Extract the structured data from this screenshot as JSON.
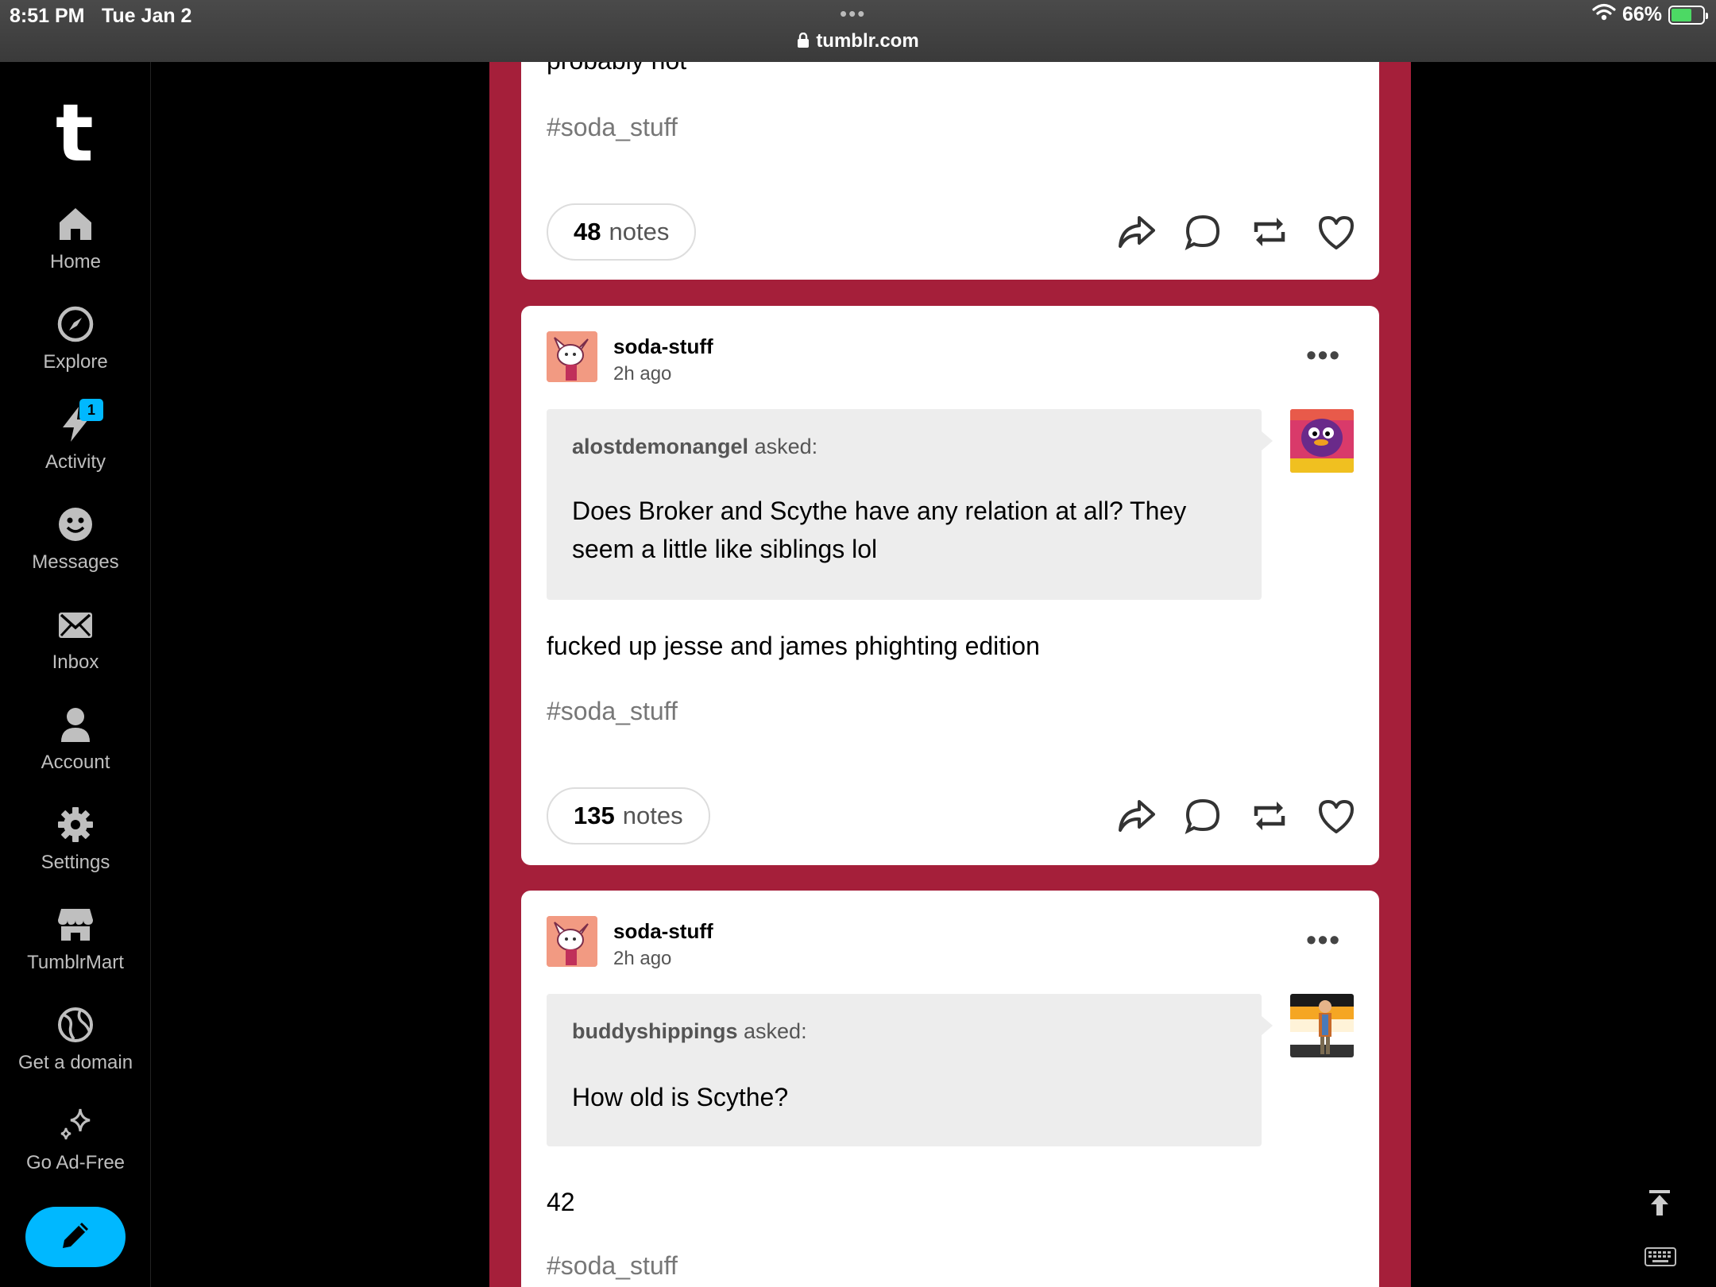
{
  "status_bar": {
    "time": "8:51 PM",
    "date": "Tue Jan 2",
    "url": "tumblr.com",
    "battery": "66%",
    "battery_level": 0.66
  },
  "sidebar": {
    "logo": "t",
    "items": [
      {
        "label": "Home",
        "icon": "home-icon"
      },
      {
        "label": "Explore",
        "icon": "compass-icon"
      },
      {
        "label": "Activity",
        "icon": "lightning-icon",
        "badge": "1"
      },
      {
        "label": "Messages",
        "icon": "smiley-icon"
      },
      {
        "label": "Inbox",
        "icon": "envelope-icon"
      },
      {
        "label": "Account",
        "icon": "person-icon"
      },
      {
        "label": "Settings",
        "icon": "gear-icon"
      },
      {
        "label": "TumblrMart",
        "icon": "store-icon"
      },
      {
        "label": "Get a domain",
        "icon": "globe-icon"
      },
      {
        "label": "Go Ad-Free",
        "icon": "sparkle-icon"
      }
    ],
    "compose_icon": "pencil-icon"
  },
  "posts": [
    {
      "cut_text": "probably not",
      "tag": "#soda_stuff",
      "notes_count": "48",
      "notes_label": "notes"
    },
    {
      "blog": "soda-stuff",
      "time": "2h ago",
      "asker": "alostdemonangel",
      "asked_label": "asked:",
      "question": "Does Broker and Scythe have any relation at all? They seem a little like siblings lol",
      "answer": "fucked up jesse and james phighting edition",
      "tag": "#soda_stuff",
      "notes_count": "135",
      "notes_label": "notes"
    },
    {
      "blog": "soda-stuff",
      "time": "2h ago",
      "asker": "buddyshippings",
      "asked_label": "asked:",
      "question": "How old is Scythe?",
      "answer": "42",
      "tag": "#soda_stuff"
    }
  ],
  "colors": {
    "feed_background": "#a51f3a",
    "accent": "#00b8ff"
  }
}
